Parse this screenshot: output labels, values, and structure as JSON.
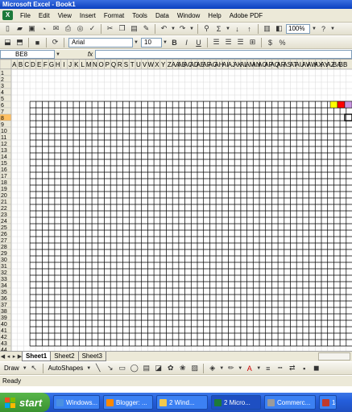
{
  "window": {
    "title": "Microsoft Excel - Book1"
  },
  "menu": [
    "File",
    "Edit",
    "View",
    "Insert",
    "Format",
    "Tools",
    "Data",
    "Window",
    "Help",
    "Adobe PDF"
  ],
  "toolbar": {
    "zoom": "100%",
    "font_name": "Arial",
    "font_size": "10",
    "bold": "B",
    "italic": "I",
    "underline": "U",
    "currency": "$",
    "percent": "%",
    "sum": "Σ"
  },
  "formula_bar": {
    "name_box": "BE8",
    "fx": "fx"
  },
  "sheet": {
    "columns": [
      "A",
      "B",
      "C",
      "D",
      "E",
      "F",
      "G",
      "H",
      "I",
      "J",
      "K",
      "L",
      "M",
      "N",
      "O",
      "P",
      "Q",
      "R",
      "S",
      "T",
      "U",
      "V",
      "W",
      "X",
      "Y",
      "Z",
      "AA",
      "AB",
      "AC",
      "AD",
      "AE",
      "AF",
      "AG",
      "AH",
      "AI",
      "AJ",
      "AK",
      "AL",
      "AM",
      "AN",
      "AO",
      "AP",
      "AQ",
      "AR",
      "AS",
      "AT",
      "AU",
      "AV",
      "AW",
      "AX",
      "AY",
      "AZ",
      "BA",
      "BB"
    ],
    "rows": [
      "1",
      "2",
      "3",
      "4",
      "5",
      "6",
      "7",
      "8",
      "9",
      "10",
      "11",
      "12",
      "13",
      "14",
      "15",
      "16",
      "17",
      "18",
      "19",
      "20",
      "21",
      "22",
      "23",
      "24",
      "25",
      "26",
      "27",
      "28",
      "29",
      "30",
      "31",
      "32",
      "33",
      "34",
      "35",
      "36",
      "37",
      "38",
      "39",
      "40",
      "41",
      "42",
      "43",
      "44"
    ],
    "selected_row": "8",
    "border_start_row": 6,
    "border_end_row": 43,
    "border_start_col": 3,
    "color_swatches": [
      "#ffff00",
      "#ff0000",
      "#c896e0"
    ]
  },
  "tabs": [
    {
      "name": "Sheet1",
      "active": true
    },
    {
      "name": "Sheet2",
      "active": false
    },
    {
      "name": "Sheet3",
      "active": false
    }
  ],
  "drawing": {
    "draw_label": "Draw",
    "autoshapes_label": "AutoShapes"
  },
  "status": {
    "text": "Ready"
  },
  "taskbar": {
    "start_label": "start",
    "items": [
      {
        "label": "Windows...",
        "color": "#4a90e2",
        "active": false
      },
      {
        "label": "Blogger: ...",
        "color": "#ff8800",
        "active": false
      },
      {
        "label": "2 Wind...",
        "color": "#f2c94c",
        "active": false
      },
      {
        "label": "2 Micro...",
        "color": "#1d7a3a",
        "active": true
      },
      {
        "label": "Commerc...",
        "color": "#9b9b9b",
        "active": false
      },
      {
        "label": "14",
        "color": "#c0392b",
        "active": false
      }
    ]
  }
}
